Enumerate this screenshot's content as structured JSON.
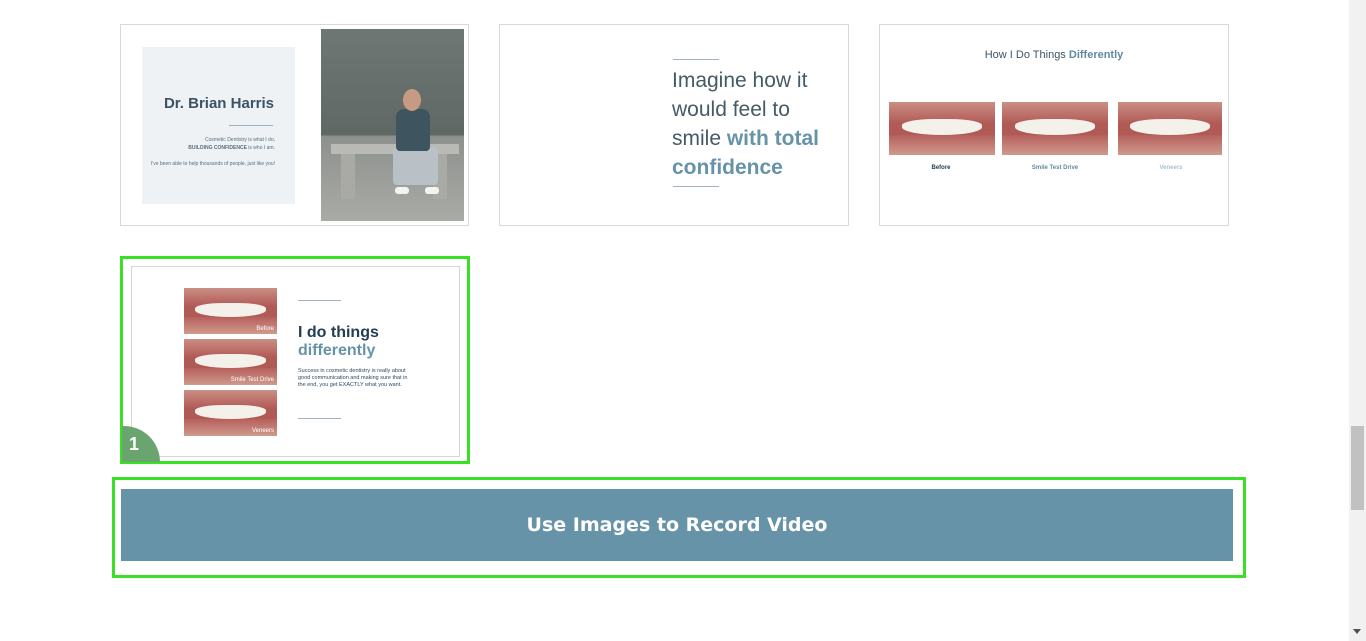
{
  "cards": {
    "card1": {
      "name": "Dr. Brian Harris",
      "text_line1": "Cosmetic Dentistry is what I do,",
      "text_bold": "BUILDING CONFIDENCE",
      "text_line2": " is who I am.",
      "text_line3": "I've been able to help thousands of people, just like you!"
    },
    "card2": {
      "headline_plain": "Imagine how it would feel to smile ",
      "headline_emph": "with total confidence"
    },
    "card3": {
      "title_plain": "How I Do Things ",
      "title_bold": "Differently",
      "labels": [
        "Before",
        "Smile Test Drive",
        "Veneers"
      ],
      "label_colors": [
        "#233e52",
        "#5f8aa0",
        "#a9c2cf"
      ]
    },
    "card4": {
      "captions": [
        "Before",
        "Smile Test Drive",
        "Veneers"
      ],
      "heading_line1": "I do things",
      "heading_line2": "differently",
      "body": "Success in cosmetic dentistry is really about good communication and making sure that in the end, you get EXACTLY what you want.",
      "badge": "1",
      "selected": true
    }
  },
  "record_button": {
    "label": "Use Images to Record Video"
  },
  "colors": {
    "accent": "#6793a8",
    "selection": "#39e025",
    "badge": "#6aa56f"
  }
}
